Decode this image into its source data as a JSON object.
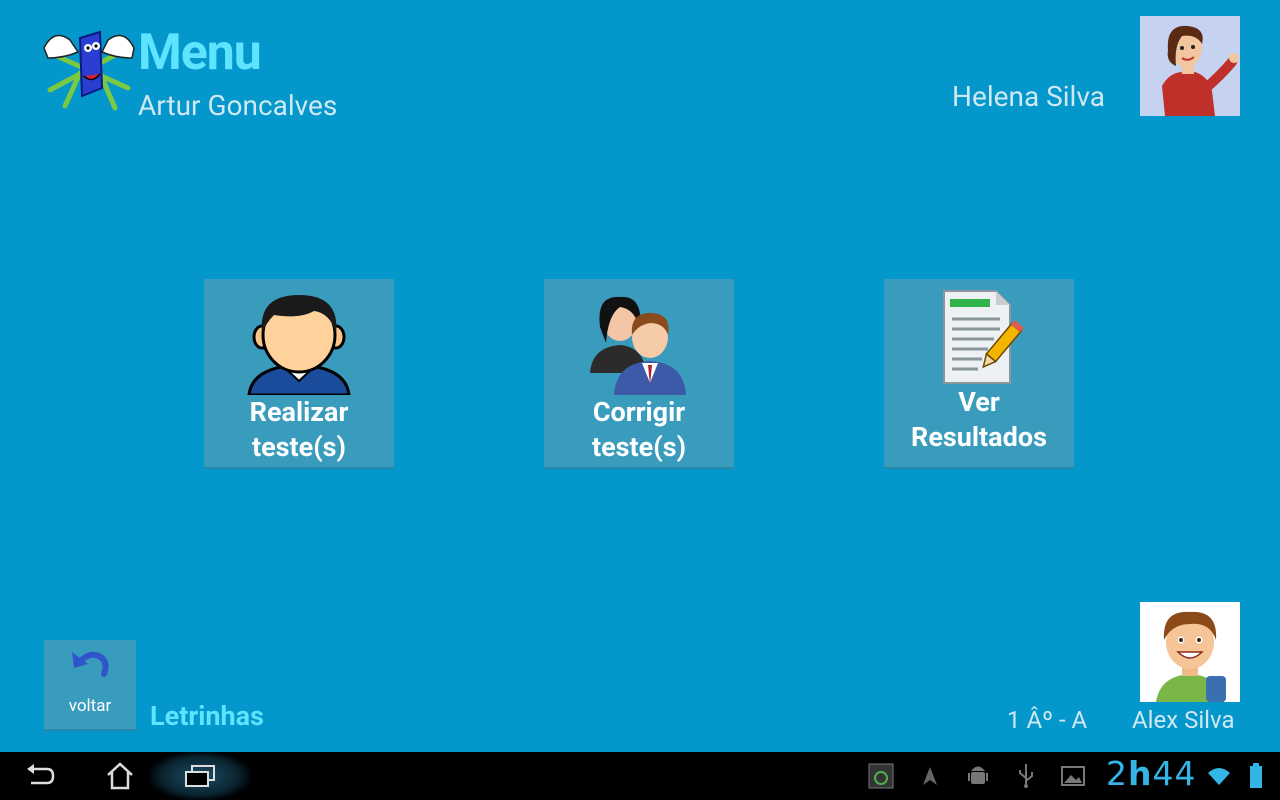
{
  "header": {
    "title": "Menu",
    "subtitle": "Artur Goncalves",
    "teacher_name": "Helena Silva"
  },
  "tiles": [
    {
      "label": "Realizar\nteste(s)",
      "icon": "student-icon"
    },
    {
      "label": "Corrigir\nteste(s)",
      "icon": "teachers-icon"
    },
    {
      "label": "Ver\nResultados",
      "icon": "report-icon"
    }
  ],
  "footer": {
    "back_label": "voltar",
    "app_name": "Letrinhas",
    "class_label": "1 Âº - A",
    "student_name": "Alex Silva"
  },
  "status_bar": {
    "time_hours": "2",
    "time_sep": "h",
    "time_minutes": "44"
  },
  "colors": {
    "background": "#0397cc",
    "tile": "#3a9cbd",
    "accent": "#5ee4ff",
    "clock": "#33b5e5"
  }
}
